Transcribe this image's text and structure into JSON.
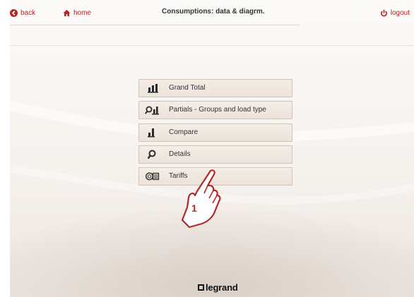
{
  "header": {
    "back_label": "back",
    "home_label": "home",
    "title": "Consumptions: data & diagrm.",
    "logout_label": "logout"
  },
  "menu": {
    "items": [
      {
        "label": "Grand Total",
        "icon": "bar-chart-icon"
      },
      {
        "label": "Partials - Groups and load type",
        "icon": "search-bars-icon"
      },
      {
        "label": "Compare",
        "icon": "compare-bars-icon"
      },
      {
        "label": "Details",
        "icon": "magnifier-icon"
      },
      {
        "label": "Tariffs",
        "icon": "tariff-icon"
      }
    ]
  },
  "callout": {
    "number": "1"
  },
  "footer": {
    "brand": "legrand"
  },
  "colors": {
    "accent": "#b52626",
    "button_bg": "#efe7df",
    "button_border": "#cfc4b8"
  }
}
